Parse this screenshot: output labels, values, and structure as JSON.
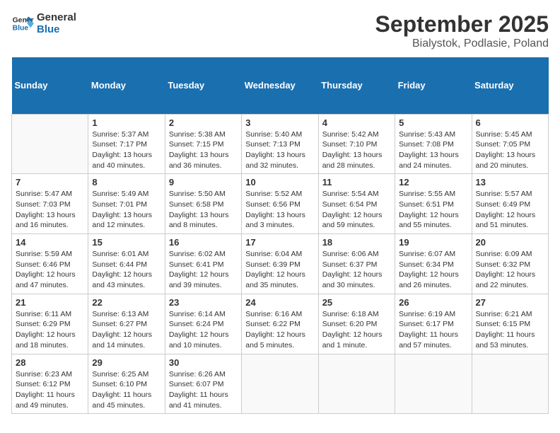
{
  "logo": {
    "line1": "General",
    "line2": "Blue"
  },
  "title": "September 2025",
  "subtitle": "Bialystok, Podlasie, Poland",
  "days_of_week": [
    "Sunday",
    "Monday",
    "Tuesday",
    "Wednesday",
    "Thursday",
    "Friday",
    "Saturday"
  ],
  "weeks": [
    [
      {
        "day": "",
        "info": ""
      },
      {
        "day": "1",
        "info": "Sunrise: 5:37 AM\nSunset: 7:17 PM\nDaylight: 13 hours\nand 40 minutes."
      },
      {
        "day": "2",
        "info": "Sunrise: 5:38 AM\nSunset: 7:15 PM\nDaylight: 13 hours\nand 36 minutes."
      },
      {
        "day": "3",
        "info": "Sunrise: 5:40 AM\nSunset: 7:13 PM\nDaylight: 13 hours\nand 32 minutes."
      },
      {
        "day": "4",
        "info": "Sunrise: 5:42 AM\nSunset: 7:10 PM\nDaylight: 13 hours\nand 28 minutes."
      },
      {
        "day": "5",
        "info": "Sunrise: 5:43 AM\nSunset: 7:08 PM\nDaylight: 13 hours\nand 24 minutes."
      },
      {
        "day": "6",
        "info": "Sunrise: 5:45 AM\nSunset: 7:05 PM\nDaylight: 13 hours\nand 20 minutes."
      }
    ],
    [
      {
        "day": "7",
        "info": "Sunrise: 5:47 AM\nSunset: 7:03 PM\nDaylight: 13 hours\nand 16 minutes."
      },
      {
        "day": "8",
        "info": "Sunrise: 5:49 AM\nSunset: 7:01 PM\nDaylight: 13 hours\nand 12 minutes."
      },
      {
        "day": "9",
        "info": "Sunrise: 5:50 AM\nSunset: 6:58 PM\nDaylight: 13 hours\nand 8 minutes."
      },
      {
        "day": "10",
        "info": "Sunrise: 5:52 AM\nSunset: 6:56 PM\nDaylight: 13 hours\nand 3 minutes."
      },
      {
        "day": "11",
        "info": "Sunrise: 5:54 AM\nSunset: 6:54 PM\nDaylight: 12 hours\nand 59 minutes."
      },
      {
        "day": "12",
        "info": "Sunrise: 5:55 AM\nSunset: 6:51 PM\nDaylight: 12 hours\nand 55 minutes."
      },
      {
        "day": "13",
        "info": "Sunrise: 5:57 AM\nSunset: 6:49 PM\nDaylight: 12 hours\nand 51 minutes."
      }
    ],
    [
      {
        "day": "14",
        "info": "Sunrise: 5:59 AM\nSunset: 6:46 PM\nDaylight: 12 hours\nand 47 minutes."
      },
      {
        "day": "15",
        "info": "Sunrise: 6:01 AM\nSunset: 6:44 PM\nDaylight: 12 hours\nand 43 minutes."
      },
      {
        "day": "16",
        "info": "Sunrise: 6:02 AM\nSunset: 6:41 PM\nDaylight: 12 hours\nand 39 minutes."
      },
      {
        "day": "17",
        "info": "Sunrise: 6:04 AM\nSunset: 6:39 PM\nDaylight: 12 hours\nand 35 minutes."
      },
      {
        "day": "18",
        "info": "Sunrise: 6:06 AM\nSunset: 6:37 PM\nDaylight: 12 hours\nand 30 minutes."
      },
      {
        "day": "19",
        "info": "Sunrise: 6:07 AM\nSunset: 6:34 PM\nDaylight: 12 hours\nand 26 minutes."
      },
      {
        "day": "20",
        "info": "Sunrise: 6:09 AM\nSunset: 6:32 PM\nDaylight: 12 hours\nand 22 minutes."
      }
    ],
    [
      {
        "day": "21",
        "info": "Sunrise: 6:11 AM\nSunset: 6:29 PM\nDaylight: 12 hours\nand 18 minutes."
      },
      {
        "day": "22",
        "info": "Sunrise: 6:13 AM\nSunset: 6:27 PM\nDaylight: 12 hours\nand 14 minutes."
      },
      {
        "day": "23",
        "info": "Sunrise: 6:14 AM\nSunset: 6:24 PM\nDaylight: 12 hours\nand 10 minutes."
      },
      {
        "day": "24",
        "info": "Sunrise: 6:16 AM\nSunset: 6:22 PM\nDaylight: 12 hours\nand 5 minutes."
      },
      {
        "day": "25",
        "info": "Sunrise: 6:18 AM\nSunset: 6:20 PM\nDaylight: 12 hours\nand 1 minute."
      },
      {
        "day": "26",
        "info": "Sunrise: 6:19 AM\nSunset: 6:17 PM\nDaylight: 11 hours\nand 57 minutes."
      },
      {
        "day": "27",
        "info": "Sunrise: 6:21 AM\nSunset: 6:15 PM\nDaylight: 11 hours\nand 53 minutes."
      }
    ],
    [
      {
        "day": "28",
        "info": "Sunrise: 6:23 AM\nSunset: 6:12 PM\nDaylight: 11 hours\nand 49 minutes."
      },
      {
        "day": "29",
        "info": "Sunrise: 6:25 AM\nSunset: 6:10 PM\nDaylight: 11 hours\nand 45 minutes."
      },
      {
        "day": "30",
        "info": "Sunrise: 6:26 AM\nSunset: 6:07 PM\nDaylight: 11 hours\nand 41 minutes."
      },
      {
        "day": "",
        "info": ""
      },
      {
        "day": "",
        "info": ""
      },
      {
        "day": "",
        "info": ""
      },
      {
        "day": "",
        "info": ""
      }
    ]
  ]
}
